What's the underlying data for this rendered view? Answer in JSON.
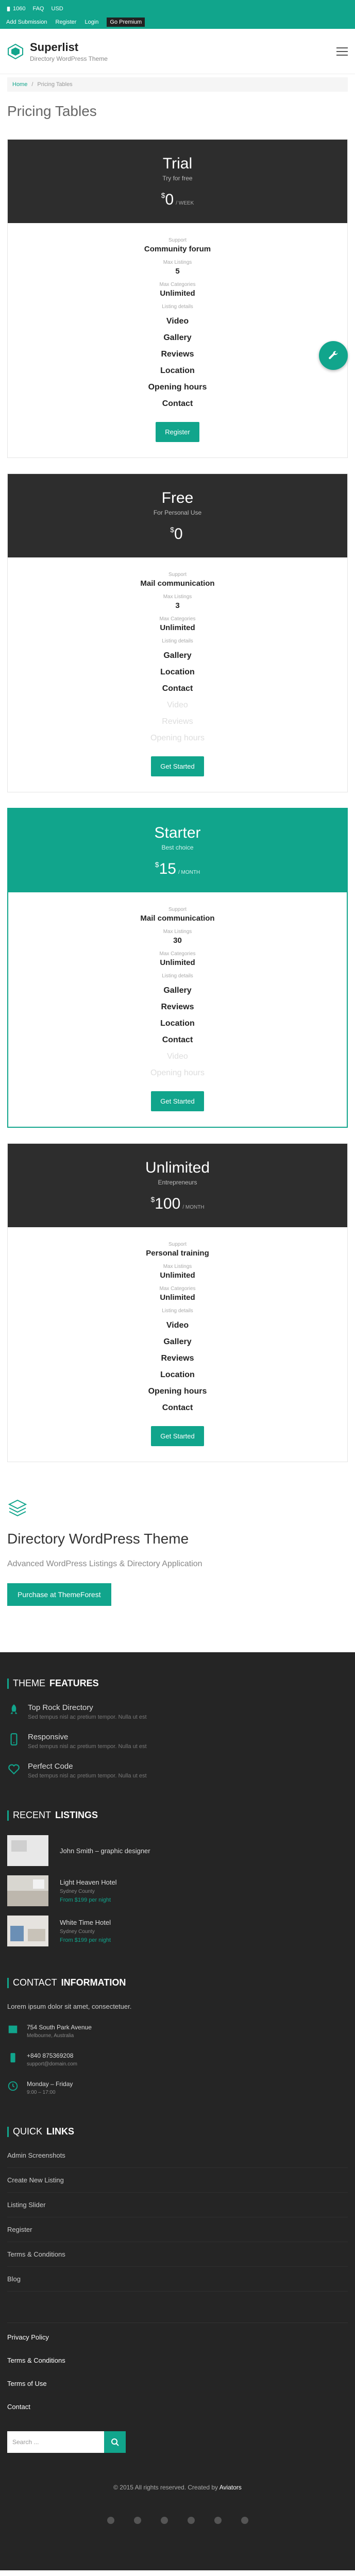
{
  "topbar": {
    "phone": "1060",
    "faq": "FAQ",
    "usd": "USD",
    "links": [
      "Add Submission",
      "Register",
      "Login",
      "Go Premium"
    ]
  },
  "header": {
    "title": "Superlist",
    "subtitle": "Directory WordPress Theme"
  },
  "breadcrumb": {
    "home": "Home",
    "current": "Pricing Tables"
  },
  "page_title": "Pricing Tables",
  "plans": [
    {
      "name": "Trial",
      "tagline": "Try for free",
      "currency": "$",
      "price": "0",
      "period": "/ WEEK",
      "support_label": "Support",
      "support": "Community forum",
      "listings_label": "Max Listings",
      "listings": "5",
      "categories_label": "Max Categories",
      "categories": "Unlimited",
      "details_label": "Listing details",
      "items": [
        "Video",
        "Gallery",
        "Reviews",
        "Location",
        "Opening hours",
        "Contact"
      ],
      "button": "Register"
    },
    {
      "name": "Free",
      "tagline": "For Personal Use",
      "currency": "$",
      "price": "0",
      "period": "",
      "support_label": "Support",
      "support": "Mail communication",
      "listings_label": "Max Listings",
      "listings": "3",
      "categories_label": "Max Categories",
      "categories": "Unlimited",
      "details_label": "Listing details",
      "items": [
        "Gallery",
        "Location",
        "Contact",
        "Video",
        "Reviews",
        "Opening hours"
      ],
      "button": "Get Started"
    },
    {
      "name": "Starter",
      "tagline": "Best choice",
      "currency": "$",
      "price": "15",
      "period": "/ MONTH",
      "support_label": "Support",
      "support": "Mail communication",
      "listings_label": "Max Listings",
      "listings": "30",
      "categories_label": "Max Categories",
      "categories": "Unlimited",
      "details_label": "Listing details",
      "items": [
        "Gallery",
        "Reviews",
        "Location",
        "Contact",
        "Video",
        "Opening hours"
      ],
      "button": "Get Started"
    },
    {
      "name": "Unlimited",
      "tagline": "Entrepreneurs",
      "currency": "$",
      "price": "100",
      "period": "/ MONTH",
      "support_label": "Support",
      "support": "Personal training",
      "listings_label": "Max Listings",
      "listings": "Unlimited",
      "categories_label": "Max Categories",
      "categories": "Unlimited",
      "details_label": "Listing details",
      "items": [
        "Video",
        "Gallery",
        "Reviews",
        "Location",
        "Opening hours",
        "Contact"
      ],
      "button": "Get Started"
    }
  ],
  "promo": {
    "title": "Directory WordPress Theme",
    "subtitle": "Advanced WordPress Listings & Directory Application",
    "button": "Purchase at ThemeForest"
  },
  "footer": {
    "features_title": "THEME",
    "features_title_bold": "FEATURES",
    "features": [
      {
        "title": "Top Rock Directory",
        "desc": "Sed tempus nisl ac pretium tempor. Nulla ut est"
      },
      {
        "title": "Responsive",
        "desc": "Sed tempus nisl ac pretium tempor. Nulla ut est"
      },
      {
        "title": "Perfect Code",
        "desc": "Sed tempus nisl ac pretium tempor. Nulla ut est"
      }
    ],
    "listings_title": "RECENT",
    "listings_title_bold": "LISTINGS",
    "listings": [
      {
        "title": "John Smith – graphic designer",
        "location": "",
        "price": ""
      },
      {
        "title": "Light Heaven Hotel",
        "location": "Sydney County",
        "price": "From $199 per night"
      },
      {
        "title": "White Time Hotel",
        "location": "Sydney County",
        "price": "From $199 per night"
      }
    ],
    "contact_title": "CONTACT",
    "contact_title_bold": "INFORMATION",
    "contact_text": "Lorem ipsum dolor sit amet, consectetuer.",
    "contacts": [
      {
        "main": "754 South Park Avenue",
        "sub": "Melbourne, Australia"
      },
      {
        "main": "+840 875369208",
        "sub": "support@domain.com"
      },
      {
        "main": "Monday – Friday",
        "sub": "9:00 – 17:00"
      }
    ],
    "quick_title": "QUICK",
    "quick_title_bold": "LINKS",
    "quick_links": [
      "Admin Screenshots",
      "Create New Listing",
      "Listing Slider",
      "Register",
      "Terms & Conditions",
      "Blog"
    ],
    "policy_links": [
      "Privacy Policy",
      "Terms & Conditions",
      "Terms of Use",
      "Contact"
    ],
    "search_placeholder": "Search ...",
    "copyright": "© 2015 All rights reserved. Created by",
    "copyright_link": "Aviators"
  }
}
